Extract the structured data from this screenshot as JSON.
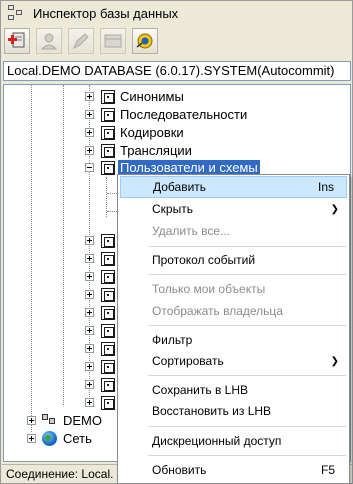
{
  "window": {
    "title": "Инспектор базы данных"
  },
  "toolbar": {
    "buttons": [
      {
        "icon": "add-database-icon",
        "enabled": true
      },
      {
        "icon": "user-icon",
        "enabled": false
      },
      {
        "icon": "edit-icon",
        "enabled": false
      },
      {
        "icon": "table-icon",
        "enabled": false
      },
      {
        "icon": "connect-icon",
        "enabled": true
      }
    ]
  },
  "database_bar": {
    "text": "Local.DEMO DATABASE (6.0.17).SYSTEM(Autocommit)"
  },
  "tree": {
    "items": [
      {
        "label": "Синонимы",
        "expandable": true
      },
      {
        "label": "Последовательности",
        "expandable": true
      },
      {
        "label": "Кодировки",
        "expandable": true
      },
      {
        "label": "Трансляции",
        "expandable": true
      },
      {
        "label": "Пользователи и схемы",
        "expandable": true,
        "expanded": true,
        "selected": true
      }
    ],
    "roots": [
      {
        "label": "DEMO",
        "icon": "database-icon"
      },
      {
        "label": "Сеть",
        "icon": "globe-icon"
      }
    ]
  },
  "status": {
    "text": "Соединение: Local."
  },
  "context_menu": {
    "items": [
      {
        "label": "Добавить",
        "shortcut": "Ins",
        "highlighted": true
      },
      {
        "label": "Скрыть",
        "submenu": true
      },
      {
        "label": "Удалить все...",
        "disabled": true
      },
      {
        "separator": true
      },
      {
        "label": "Протокол событий"
      },
      {
        "separator": true
      },
      {
        "label": "Только мои объекты",
        "disabled": true
      },
      {
        "label": "Отображать владельца",
        "disabled": true
      },
      {
        "separator": true
      },
      {
        "label": "Фильтр"
      },
      {
        "label": "Сортировать",
        "submenu": true
      },
      {
        "separator": true
      },
      {
        "label": "Сохранить в LHB"
      },
      {
        "label": "Восстановить из LHB"
      },
      {
        "separator": true
      },
      {
        "label": "Дискреционный доступ"
      },
      {
        "separator": true
      },
      {
        "label": "Обновить",
        "shortcut": "F5"
      }
    ]
  },
  "colors": {
    "selection": "#316ac5",
    "menu_highlight": "#cce8ff",
    "border": "#7f9db9"
  }
}
